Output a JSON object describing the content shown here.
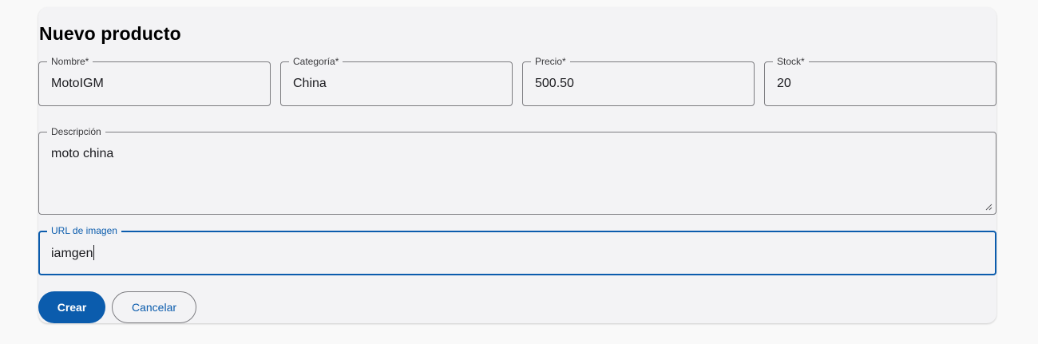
{
  "form": {
    "title": "Nuevo producto",
    "fields": {
      "nombre": {
        "label": "Nombre*",
        "value": "MotoIGM"
      },
      "categoria": {
        "label": "Categoría*",
        "value": "China"
      },
      "precio": {
        "label": "Precio*",
        "value": "500.50"
      },
      "stock": {
        "label": "Stock*",
        "value": "20"
      },
      "descripcion": {
        "label": "Descripción",
        "value": "moto china"
      },
      "imagen": {
        "label": "URL de imagen",
        "value": "iamgen"
      }
    },
    "actions": {
      "create_label": "Crear",
      "cancel_label": "Cancelar"
    }
  },
  "colors": {
    "accent": "#0b5cad",
    "card_background": "#f3f3f5",
    "page_background": "#f9f9f9",
    "outline": "#7c7c80"
  },
  "icons": {
    "resize_handle": "resize-grip-icon"
  }
}
